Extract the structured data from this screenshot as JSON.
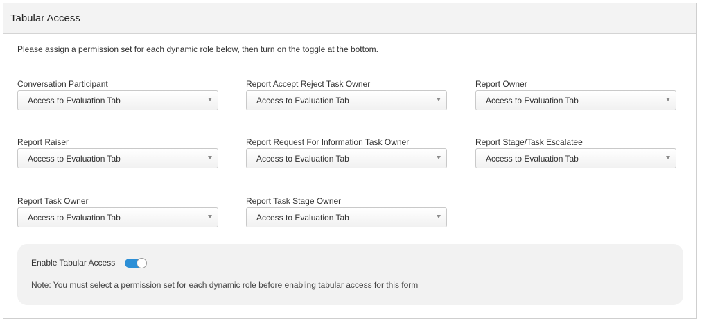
{
  "panel": {
    "title": "Tabular Access"
  },
  "intro": "Please assign a permission set for each dynamic role below, then turn on the toggle at the bottom.",
  "roles": [
    {
      "label": "Conversation Participant",
      "value": "Access to Evaluation Tab"
    },
    {
      "label": "Report Accept Reject Task Owner",
      "value": "Access to Evaluation Tab"
    },
    {
      "label": "Report Owner",
      "value": "Access to Evaluation Tab"
    },
    {
      "label": "Report Raiser",
      "value": "Access to Evaluation Tab"
    },
    {
      "label": "Report Request For Information Task Owner",
      "value": "Access to Evaluation Tab"
    },
    {
      "label": "Report Stage/Task Escalatee",
      "value": "Access to Evaluation Tab"
    },
    {
      "label": "Report Task Owner",
      "value": "Access to Evaluation Tab"
    },
    {
      "label": "Report Task Stage Owner",
      "value": "Access to Evaluation Tab"
    }
  ],
  "enable": {
    "label": "Enable Tabular Access",
    "toggle_on": true,
    "note": "Note: You must select a permission set for each dynamic role before enabling tabular access for this form"
  },
  "colors": {
    "toggle_accent": "#2c8fd6",
    "panel_header_bg": "#f3f3f3",
    "enable_box_bg": "#f2f2f2"
  }
}
